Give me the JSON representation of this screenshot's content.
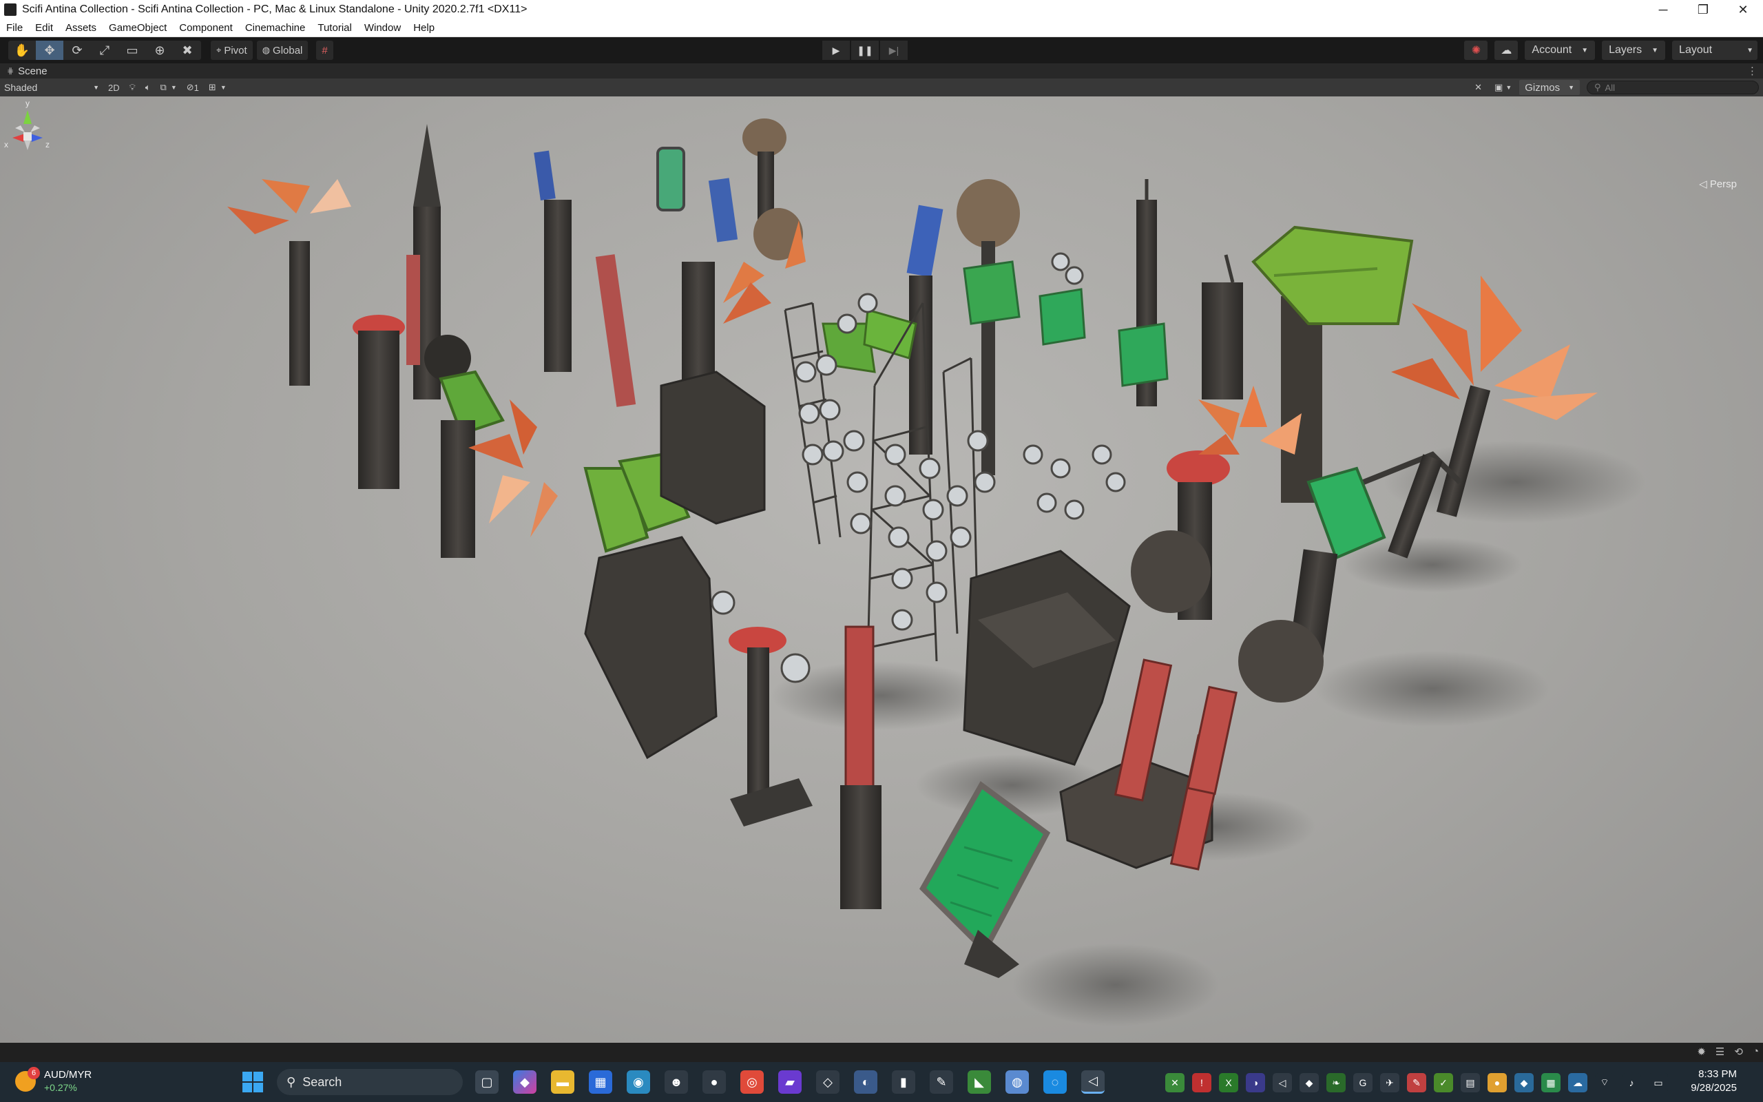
{
  "window": {
    "title": "Scifi Antina Collection - Scifi Antina Collection - PC, Mac & Linux Standalone - Unity 2020.2.7f1 <DX11>",
    "minimize": "─",
    "restore": "❐",
    "close": "✕"
  },
  "menu": [
    "File",
    "Edit",
    "Assets",
    "GameObject",
    "Component",
    "Cinemachine",
    "Tutorial",
    "Window",
    "Help"
  ],
  "toolbar": {
    "tools": [
      {
        "name": "hand-tool",
        "glyph": "✋",
        "active": false
      },
      {
        "name": "move-tool",
        "glyph": "✥",
        "active": true
      },
      {
        "name": "rotate-tool",
        "glyph": "⟳",
        "active": false
      },
      {
        "name": "scale-tool",
        "glyph": "⤢",
        "active": false
      },
      {
        "name": "rect-tool",
        "glyph": "▭",
        "active": false
      },
      {
        "name": "transform-tool",
        "glyph": "⊕",
        "active": false
      },
      {
        "name": "custom-tool",
        "glyph": "✖",
        "active": false
      }
    ],
    "pivot_label": "Pivot",
    "global_label": "Global",
    "play": "▶",
    "pause": "❚❚",
    "step": "▶|",
    "account_label": "Account",
    "layers_label": "Layers",
    "layout_label": "Layout"
  },
  "scene": {
    "tab_label": "Scene",
    "shading_mode": "Shaded",
    "mode_2d": "2D",
    "hidden_count": "1",
    "gizmos_label": "Gizmos",
    "search_placeholder": "All",
    "projection_label": "◁ Persp",
    "axis_x": "x",
    "axis_y": "y",
    "axis_z": "z"
  },
  "taskbar": {
    "widget_pair": "AUD/MYR",
    "widget_change": "+0.27%",
    "widget_badge": "6",
    "search_label": "Search",
    "time": "8:33 PM",
    "date": "9/28/2025"
  },
  "colors": {
    "accent_blue": "#46607c",
    "toolbar_bg": "#191919",
    "ground": "#a6a5a2",
    "panel_green": "#3fae4a",
    "panel_orange": "#e0783c",
    "cap_red": "#d04a44",
    "metal": "#3a3835"
  }
}
